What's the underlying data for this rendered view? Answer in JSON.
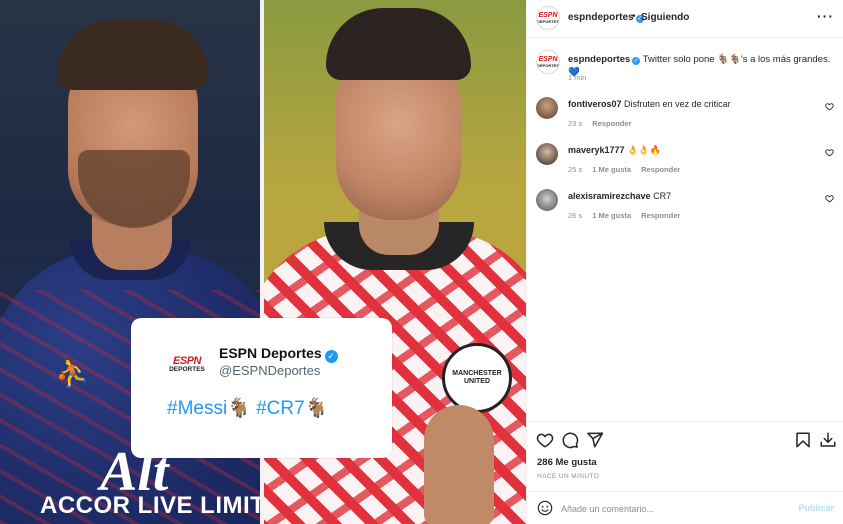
{
  "media": {
    "tweet": {
      "logo_line1": "ESPN",
      "logo_line2": "DEPORTES",
      "name": "ESPN Deportes",
      "handle": "@ESPNDeportes",
      "text": "#Messi🐐 #CR7🐐"
    },
    "jersey_left_text": "ACCOR LIVE LIMITLE",
    "jersey_left_big": "Alt",
    "crest_text": "MANCHESTER UNITED"
  },
  "header": {
    "username": "espndeportes",
    "verified_icon": "✓",
    "separator": "•",
    "follow_status": "Siguiendo",
    "more_icon": "···",
    "avatar_line1": "ESPN",
    "avatar_line2": "DEPORTES"
  },
  "caption": {
    "username": "espndeportes",
    "text": "Twitter solo pone 🐐🐐's a los más grandes.💙",
    "time": "1 min"
  },
  "comments": [
    {
      "username": "fontiveros07",
      "text": "Disfruten en vez de criticar",
      "time": "23 s",
      "likes": "",
      "reply": "Responder"
    },
    {
      "username": "maveryk1777",
      "text": "👌👌🔥",
      "time": "25 s",
      "likes": "1 Me gusta",
      "reply": "Responder"
    },
    {
      "username": "alexisramirezchave",
      "text": "CR7",
      "time": "26 s",
      "likes": "1 Me gusta",
      "reply": "Responder"
    }
  ],
  "actions": {
    "icons": [
      "heart-icon",
      "comment-icon",
      "share-icon",
      "bookmark-icon",
      "download-icon"
    ]
  },
  "likes_text": "286 Me gusta",
  "posted_time": "Hace un minuto",
  "add_comment": {
    "placeholder": "Añade un comentario...",
    "publish_label": "Publicar"
  },
  "colors": {
    "verified": "#3897f0",
    "twitter_blue": "#1d9bf0",
    "espn_red": "#d71920",
    "publish_disabled": "#b2dffc",
    "muted": "#8e8e8e"
  }
}
